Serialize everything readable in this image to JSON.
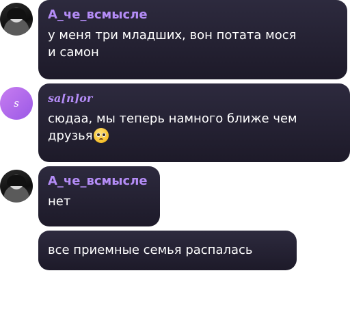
{
  "messages": [
    {
      "sender": "А_че_всмысле",
      "text_lines": [
        "у меня три младших, вон потата мося",
        "и самон"
      ]
    },
    {
      "sender": "sa[n]or",
      "avatar_letter": "s",
      "text_lines": [
        "сюдаа, мы теперь намного ближе чем",
        "друзья"
      ],
      "emoji": "pleading-face"
    },
    {
      "sender": "А_че_всмысле",
      "text": "нет"
    },
    {
      "text": "все приемные семья распалась"
    }
  ],
  "colors": {
    "bubble": "#231f32",
    "sender_name": "#b48cf6",
    "message_text": "#ffffff",
    "avatar_letter_bg": "#b36aee"
  }
}
